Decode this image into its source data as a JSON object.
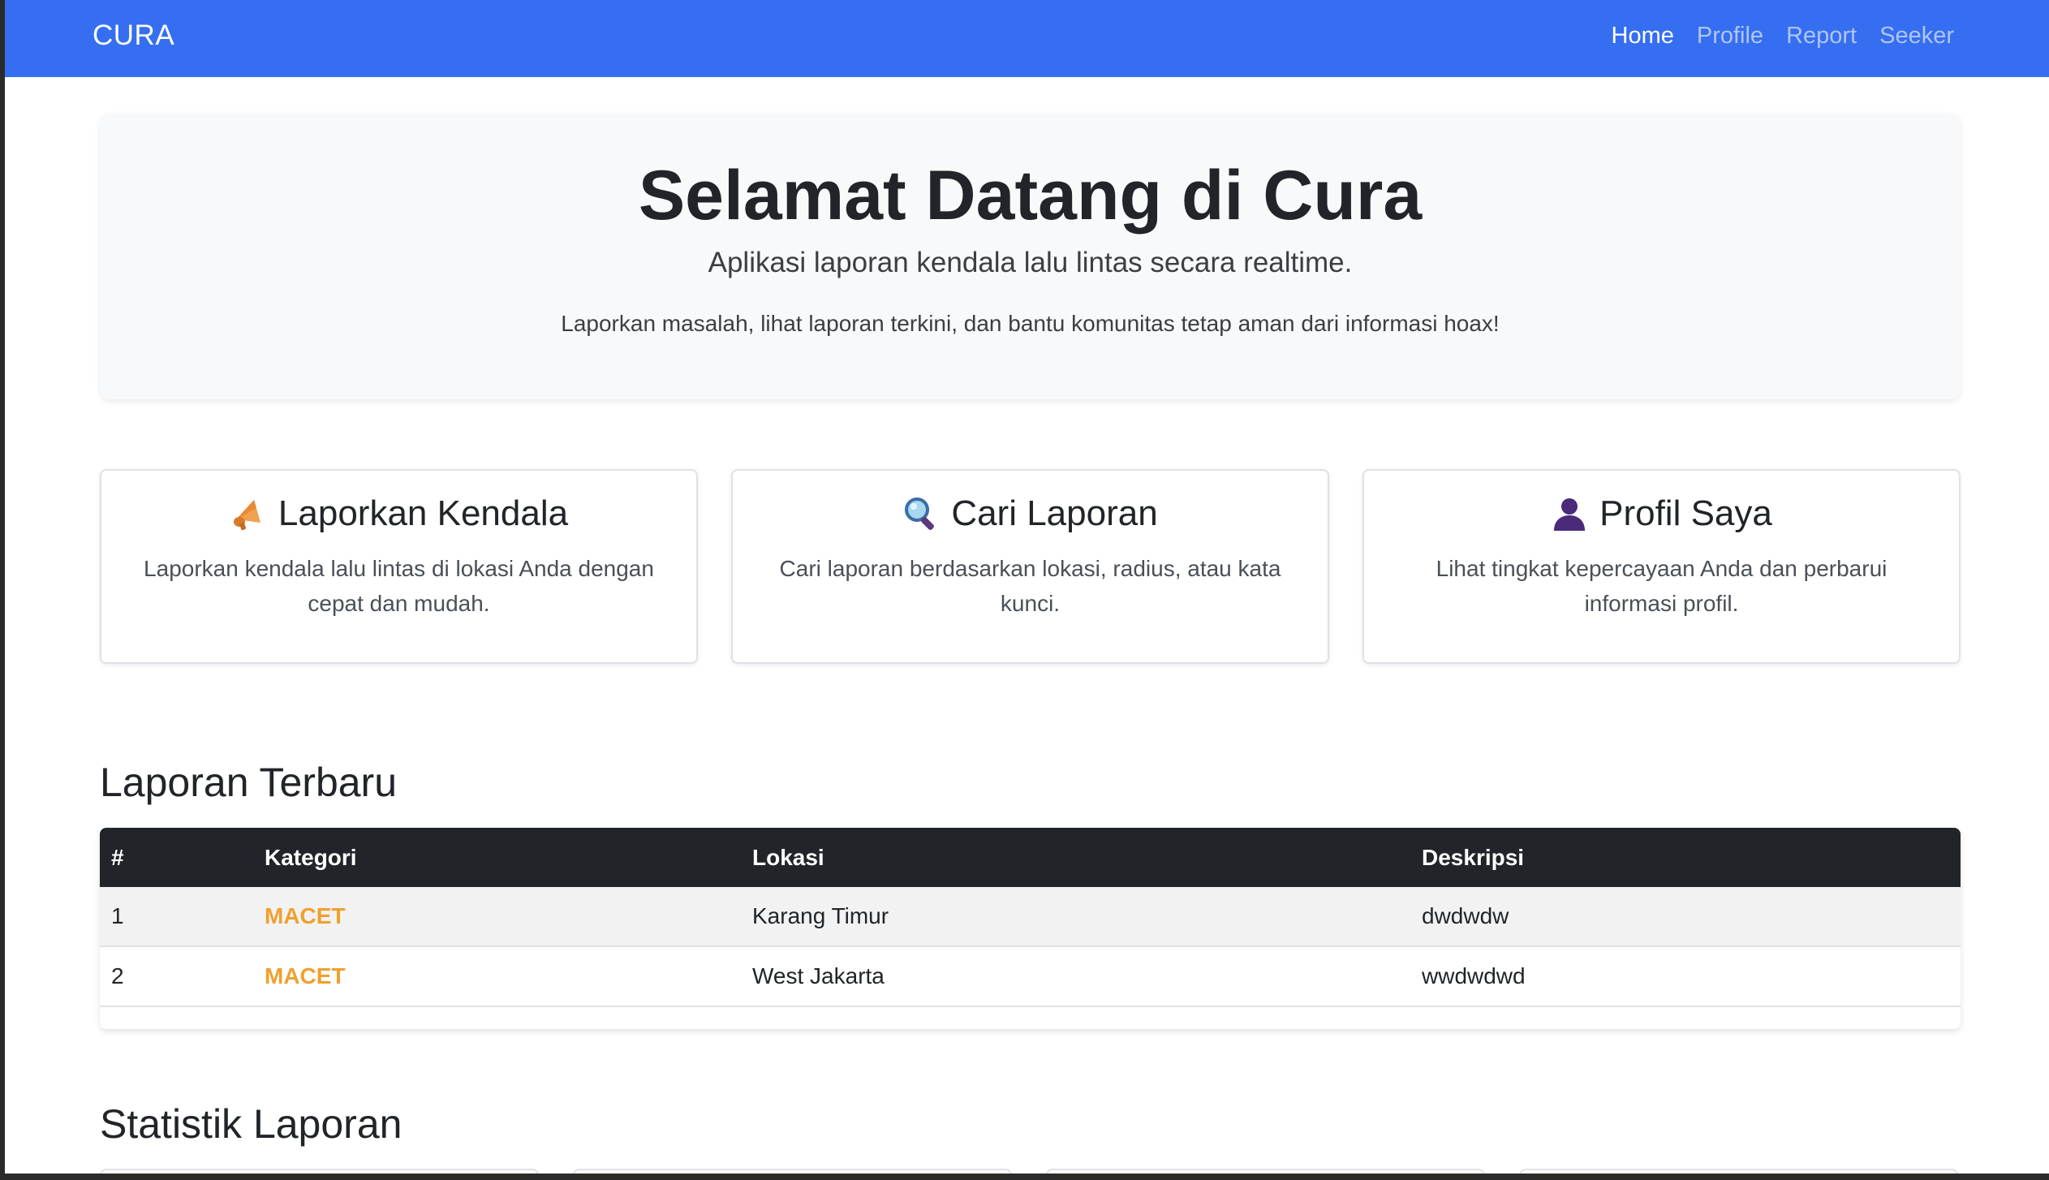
{
  "navbar": {
    "brand": "CURA",
    "links": [
      "Home",
      "Profile",
      "Report",
      "Seeker"
    ],
    "active": "Home"
  },
  "hero": {
    "title": "Selamat Datang di Cura",
    "subtitle": "Aplikasi laporan kendala lalu lintas secara realtime.",
    "text": "Laporkan masalah, lihat laporan terkini, dan bantu komunitas tetap aman dari informasi hoax!"
  },
  "cards": [
    {
      "icon": "megaphone-icon",
      "title": "Laporkan Kendala",
      "text": "Laporkan kendala lalu lintas di lokasi Anda dengan cepat dan mudah."
    },
    {
      "icon": "magnifier-icon",
      "title": "Cari Laporan",
      "text": "Cari laporan berdasarkan lokasi, radius, atau kata kunci."
    },
    {
      "icon": "user-icon",
      "title": "Profil Saya",
      "text": "Lihat tingkat kepercayaan Anda dan perbarui informasi profil."
    }
  ],
  "reports": {
    "title": "Laporan Terbaru",
    "headers": [
      "#",
      "Kategori",
      "Lokasi",
      "Deskripsi"
    ],
    "rows": [
      [
        "1",
        "MACET",
        "Karang Timur",
        "dwdwdw"
      ],
      [
        "2",
        "MACET",
        "West Jakarta",
        "wwdwdwd"
      ]
    ]
  },
  "stats": {
    "title": "Statistik Laporan"
  },
  "colors": {
    "navbar": "#356ef0",
    "category": "#f0a030",
    "table_header": "#212529"
  }
}
